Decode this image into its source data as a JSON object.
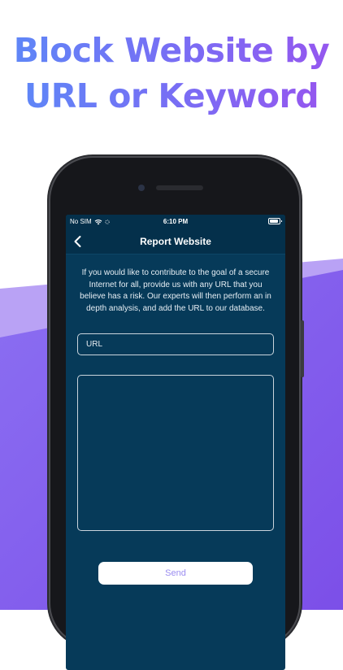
{
  "headline": {
    "line1": "Block Website by",
    "line2": "URL or Keyword"
  },
  "status_bar": {
    "carrier": "No SIM",
    "time": "6:10 PM"
  },
  "nav": {
    "title": "Report Website"
  },
  "description": "If you would like to contribute to the goal of a secure Internet for all, provide us with any URL that you believe has a risk. Our experts will then perform an in depth analysis, and add the URL to our database.",
  "url_input": {
    "placeholder": "URL",
    "value": ""
  },
  "message_input": {
    "value": ""
  },
  "send_button": {
    "label": "Send"
  },
  "colors": {
    "screen_bg": "#063a59",
    "accent_purple": "#8b5cf6",
    "headline_blue": "#5f86f7"
  },
  "icons": [
    "wifi-icon",
    "signal-icon",
    "battery-icon",
    "back-chevron-icon"
  ]
}
